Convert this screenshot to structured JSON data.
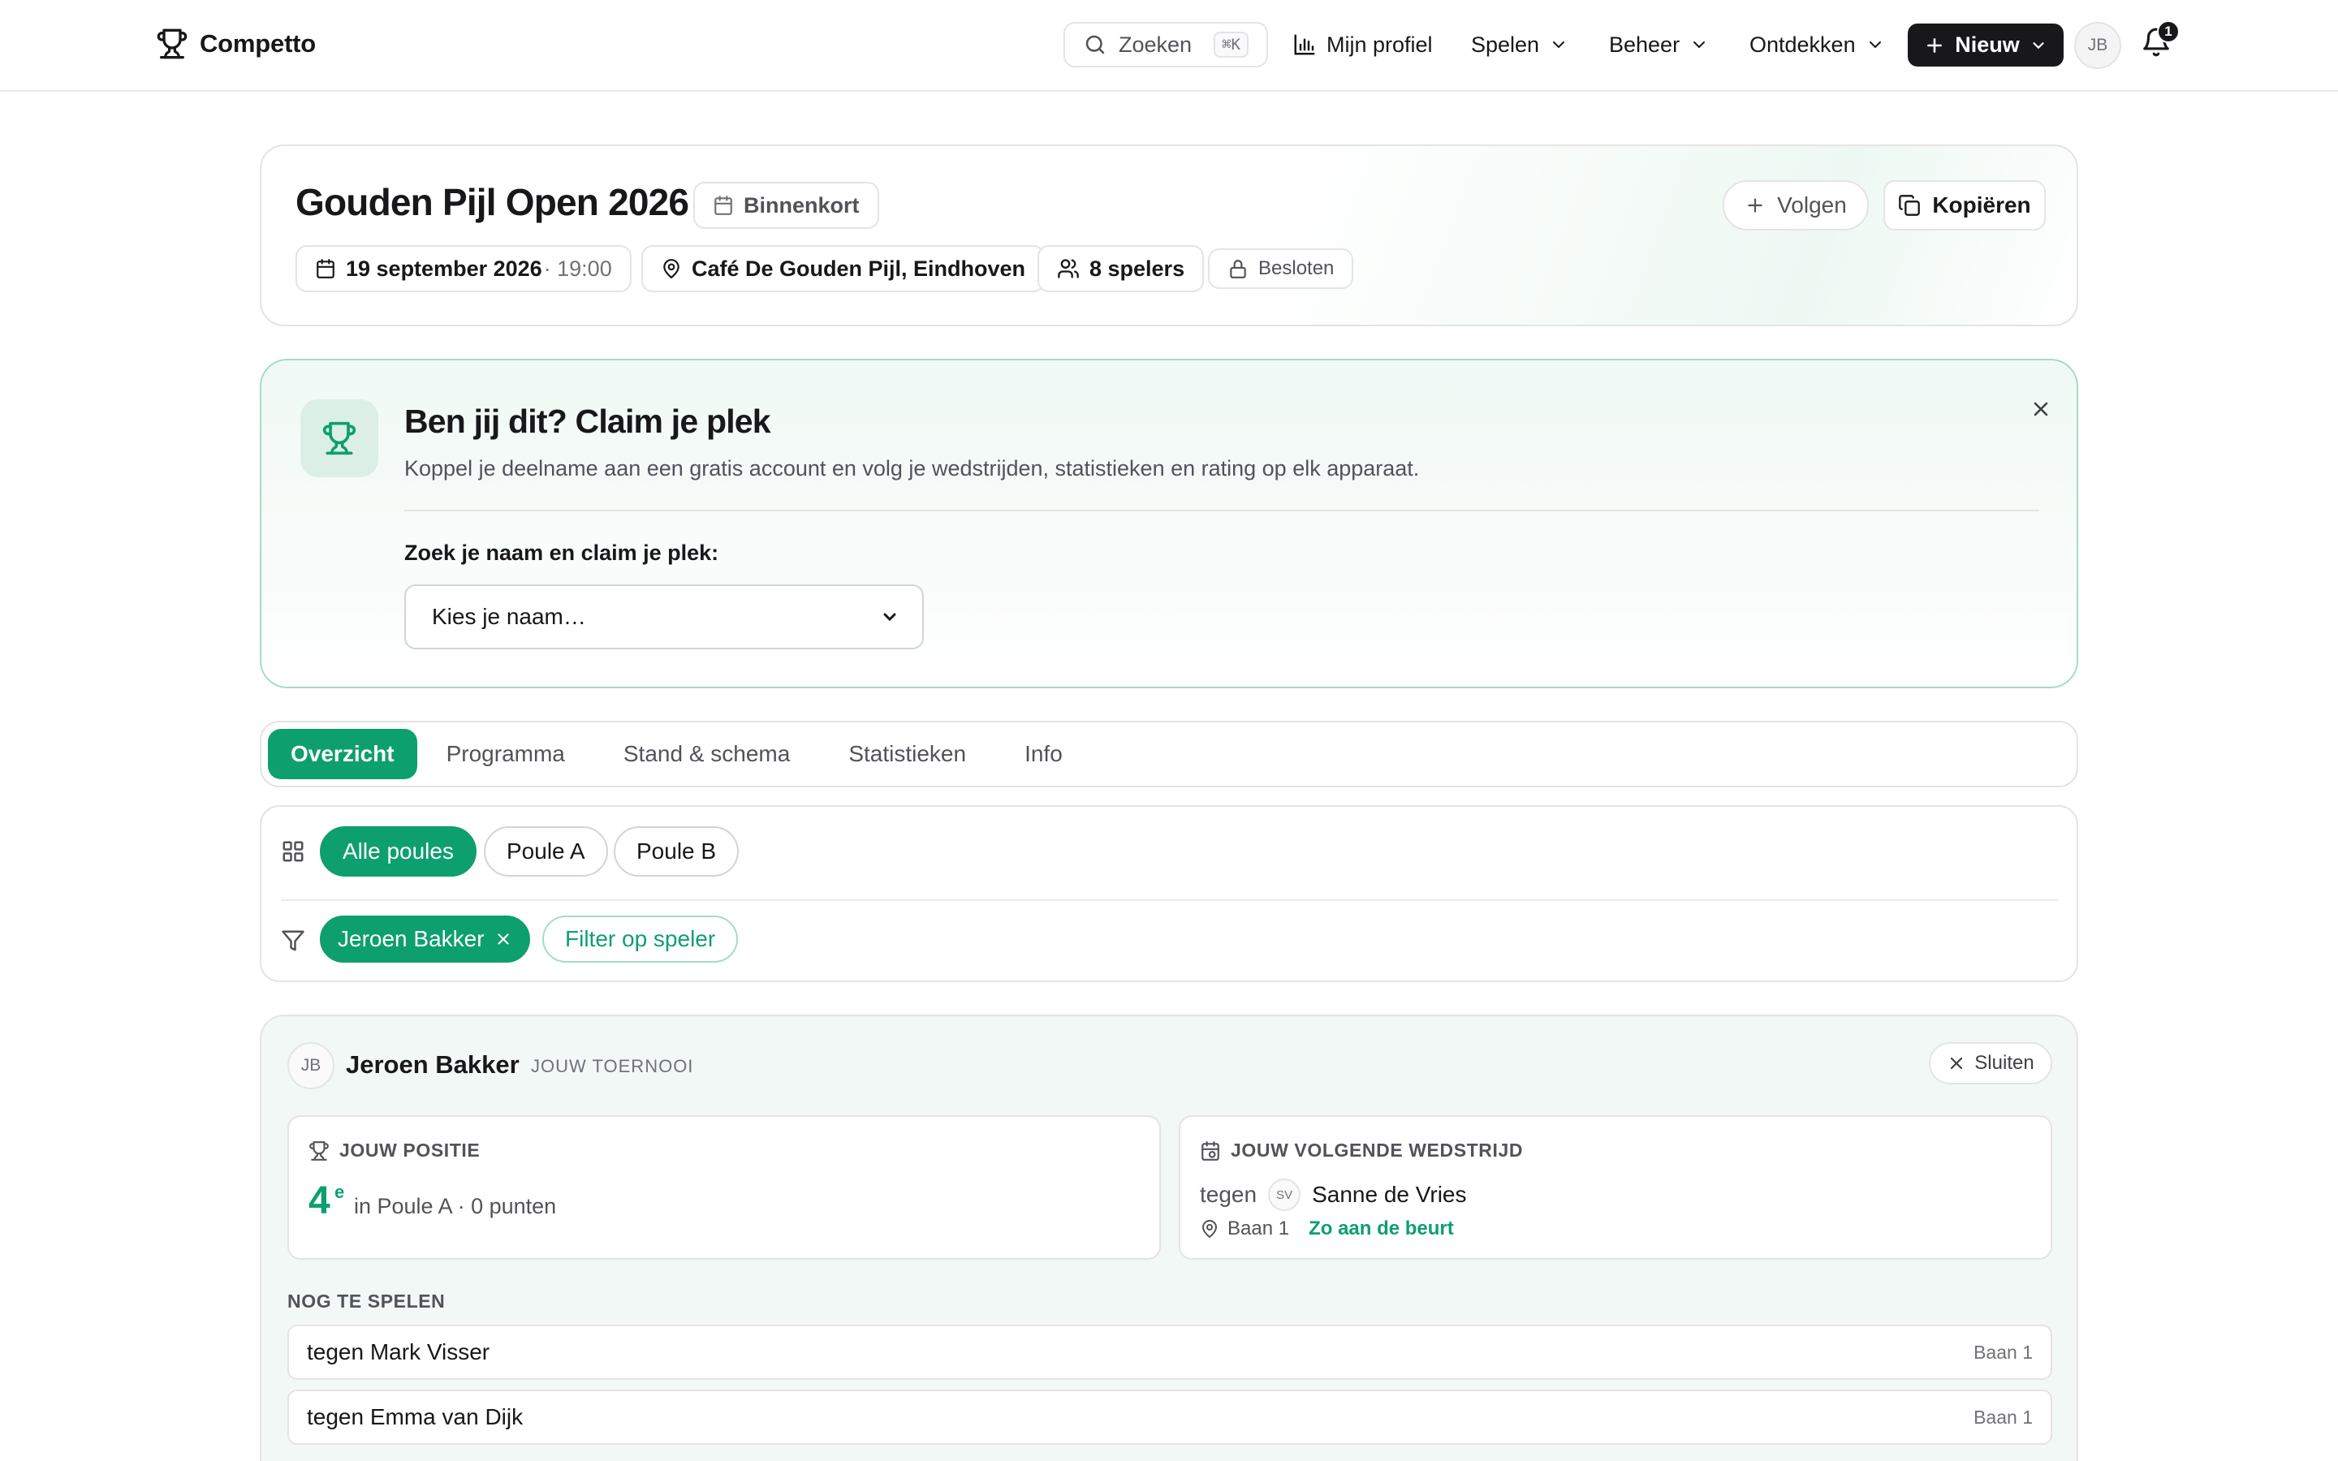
{
  "app": {
    "name": "Competto"
  },
  "nav": {
    "search_label": "Zoeken",
    "search_shortcut": "⌘K",
    "profile": "Mijn profiel",
    "play": "Spelen",
    "manage": "Beheer",
    "discover": "Ontdekken",
    "new_button": "Nieuw",
    "user_initials": "JB",
    "notification_count": "1"
  },
  "tournament": {
    "title": "Gouden Pijl Open 2026",
    "status": "Binnenkort",
    "date": "19 september 2026",
    "time": "· 19:00",
    "venue": "Café De Gouden Pijl, Eindhoven",
    "players": "8 spelers",
    "privacy": "Besloten",
    "follow_label": "Volgen",
    "copy_label": "Kopiëren"
  },
  "claim": {
    "title": "Ben jij dit? Claim je plek",
    "subtitle": "Koppel je deelname aan een gratis account en volg je wedstrijden, statistieken en rating op elk apparaat.",
    "select_label": "Zoek je naam en claim je plek:",
    "select_placeholder": "Kies je naam…"
  },
  "tabs": [
    {
      "label": "Overzicht",
      "active": true
    },
    {
      "label": "Programma",
      "active": false
    },
    {
      "label": "Stand & schema",
      "active": false
    },
    {
      "label": "Statistieken",
      "active": false
    },
    {
      "label": "Info",
      "active": false
    }
  ],
  "filters": {
    "pools": [
      {
        "label": "Alle poules",
        "active": true
      },
      {
        "label": "Poule A",
        "active": false
      },
      {
        "label": "Poule B",
        "active": false
      }
    ],
    "active_player": "Jeroen Bakker",
    "filter_player_label": "Filter op speler"
  },
  "player_panel": {
    "initials": "JB",
    "name": "Jeroen Bakker",
    "tag": "JOUW TOERNOOI",
    "close_label": "Sluiten",
    "position": {
      "heading": "JOUW POSITIE",
      "rank": "4",
      "rank_suffix": "e",
      "detail": "in Poule A · 0 punten"
    },
    "next_match": {
      "heading": "JOUW VOLGENDE WEDSTRIJD",
      "prefix": "tegen",
      "opponent_initials": "SV",
      "opponent": "Sanne de Vries",
      "court": "Baan 1",
      "turn_note": "Zo aan de beurt"
    },
    "upcoming_heading": "NOG TE SPELEN",
    "upcoming": [
      {
        "opponent": "tegen Mark Visser",
        "court": "Baan 1"
      },
      {
        "opponent": "tegen Emma van Dijk",
        "court": "Baan 1"
      }
    ]
  },
  "colors": {
    "accent": "#0e9f6e",
    "dark": "#18181b",
    "claim_border": "#a6dcc4"
  }
}
